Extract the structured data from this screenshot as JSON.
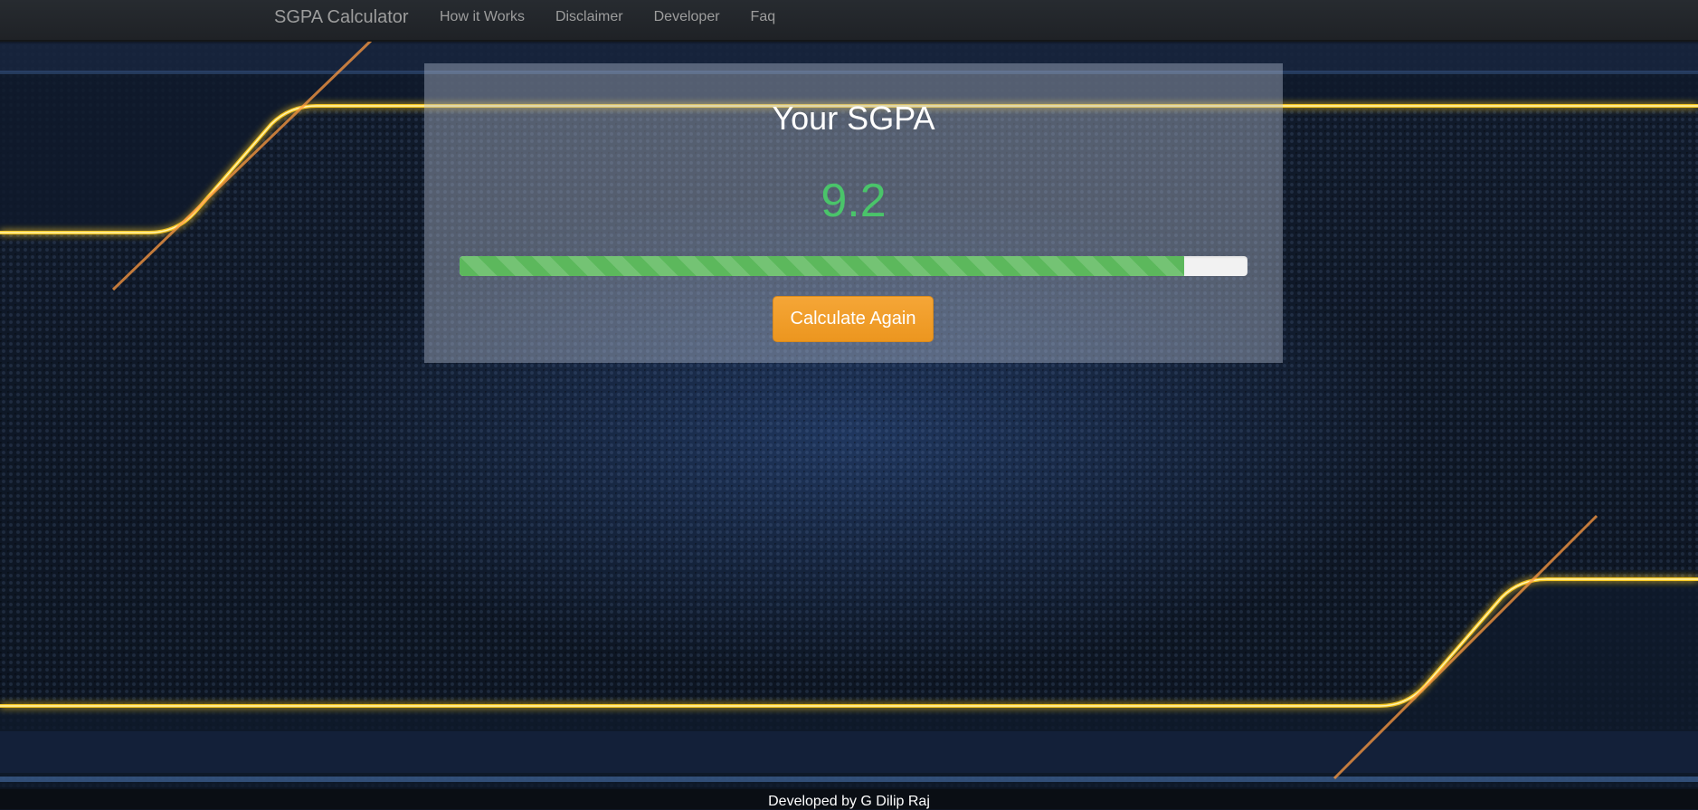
{
  "navbar": {
    "brand": "SGPA Calculator",
    "links": [
      "How it Works",
      "Disclaimer",
      "Developer",
      "Faq"
    ]
  },
  "result": {
    "title": "Your SGPA",
    "sgpa": "9.2",
    "progress_percent": 92,
    "button_label": "Calculate Again"
  },
  "footer": {
    "text": "Developed by G Dilip Raj"
  },
  "colors": {
    "navbar_bg": "#272b30",
    "nav_text": "#9d9d9d",
    "sgpa_value": "#4ac46a",
    "progress_bar": "#5cb85c",
    "button_bg": "#f0a030",
    "glow_line": "#f6c623"
  }
}
